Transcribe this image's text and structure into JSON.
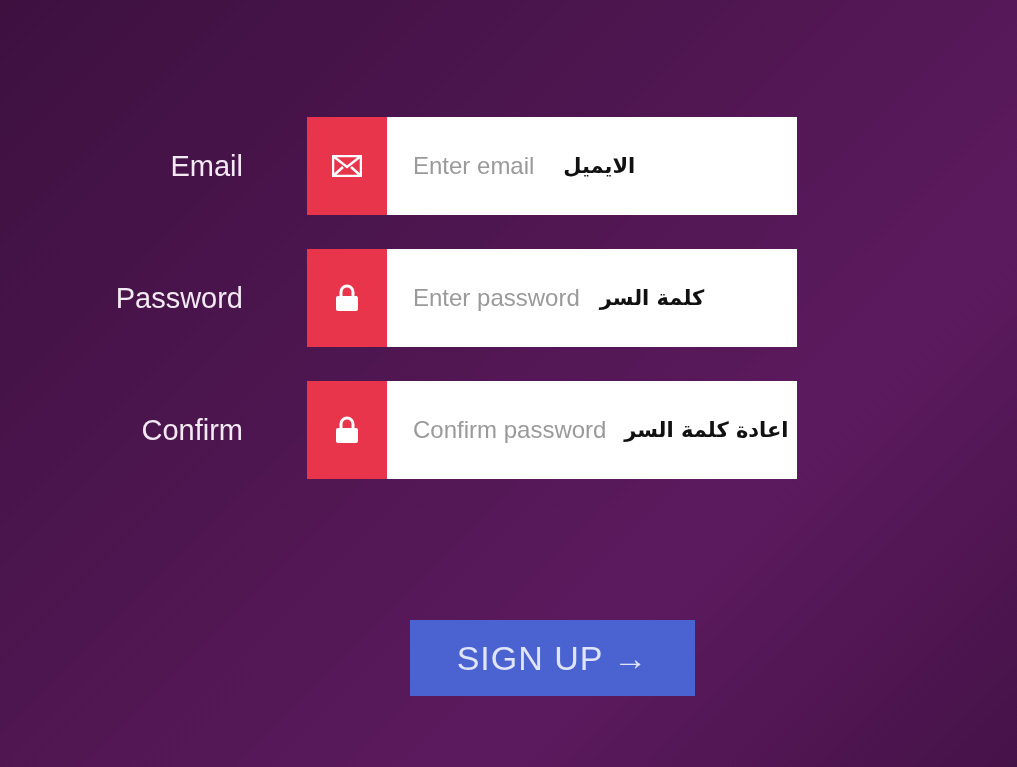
{
  "fields": [
    {
      "label": "Email",
      "kind": "email",
      "placeholder": "Enter email",
      "annotation": "الايميل"
    },
    {
      "label": "Password",
      "kind": "password",
      "placeholder": "Enter password",
      "annotation": "كلمة السر"
    },
    {
      "label": "Confirm",
      "kind": "password",
      "placeholder": "Confirm password",
      "annotation": "اعادة كلمة السر"
    }
  ],
  "button": {
    "label": "SIGN UP →"
  }
}
